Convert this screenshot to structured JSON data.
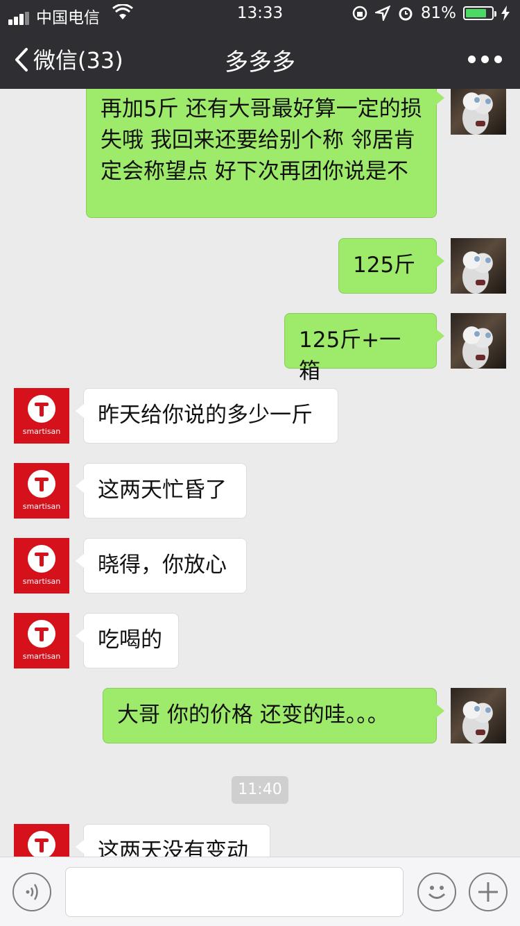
{
  "status_bar": {
    "carrier": "中国电信",
    "time": "13:33",
    "battery_percent": "81%",
    "battery_level": 0.81
  },
  "nav": {
    "back_label": "微信(33)",
    "title": "多多多"
  },
  "avatars": {
    "smartisan_brand": "smartisan"
  },
  "messages": [
    {
      "direction": "out",
      "text": "再加5斤 还有大哥最好算一定的损失哦 我回来还要给别个称 邻居肯定会称望点 好下次再团你说是不"
    },
    {
      "direction": "out",
      "text": "125斤"
    },
    {
      "direction": "out",
      "text": "125斤+一箱"
    },
    {
      "direction": "in",
      "text": "昨天给你说的多少一斤"
    },
    {
      "direction": "in",
      "text": "这两天忙昏了"
    },
    {
      "direction": "in",
      "text": "晓得，你放心"
    },
    {
      "direction": "in",
      "text": "吃喝的"
    },
    {
      "direction": "out",
      "text": "大哥 你的价格 还变的哇。。。"
    },
    {
      "direction": "in",
      "text": "这两天没有变动"
    }
  ],
  "timestamp": "11:40",
  "colors": {
    "outgoing_bubble": "#9eea6a",
    "incoming_bubble": "#ffffff",
    "nav_bg": "#2f2f33",
    "smartisan_red": "#d5111b"
  },
  "icons": {
    "back": "chevron-left-icon",
    "more": "more-dots-icon",
    "voice": "voice-icon",
    "emoji": "emoji-icon",
    "plus": "plus-icon"
  }
}
